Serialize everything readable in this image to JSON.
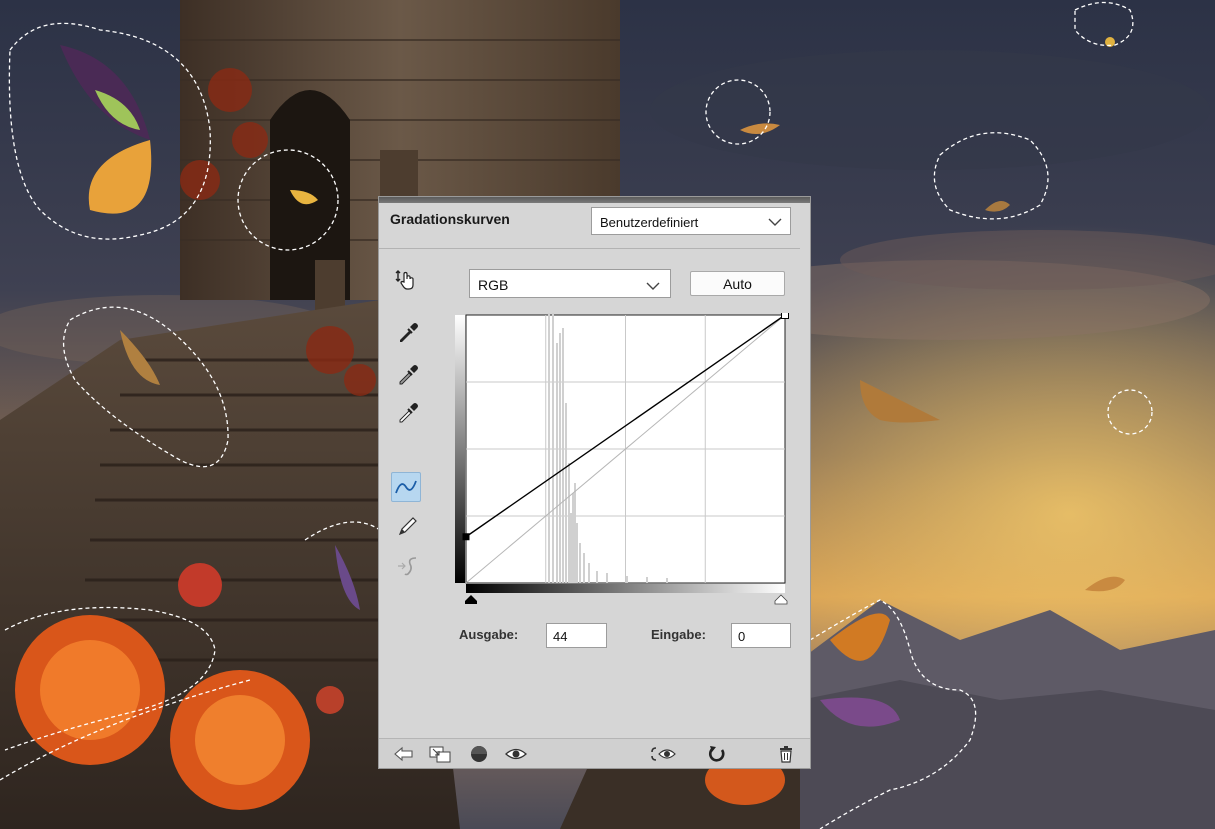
{
  "panel": {
    "title": "Gradationskurven",
    "preset": {
      "selected": "Benutzerdefiniert"
    },
    "channel": {
      "selected": "RGB"
    },
    "auto_label": "Auto",
    "output_label": "Ausgabe:",
    "output_value": "44",
    "input_label": "Eingabe:",
    "input_value": "0"
  },
  "curve": {
    "points": [
      {
        "input": 0,
        "output": 44
      },
      {
        "input": 255,
        "output": 255
      }
    ],
    "range": [
      0,
      255
    ],
    "grid_divisions": 4
  },
  "tools": [
    "target-adjust-icon",
    "black-point-eyedropper-icon",
    "gray-point-eyedropper-icon",
    "white-point-eyedropper-icon",
    "curve-points-icon",
    "pencil-draw-icon",
    "smooth-curve-icon"
  ],
  "bottom_icons": [
    "back-arrow-icon",
    "clip-to-layer-icon",
    "layer-mask-icon",
    "visibility-eye-icon",
    "view-previous-state-icon",
    "reset-icon",
    "trash-icon"
  ],
  "colors": {
    "panel_bg": "#d6d6d6",
    "active_tool": "#b7d7f0",
    "curve": "#000000"
  }
}
